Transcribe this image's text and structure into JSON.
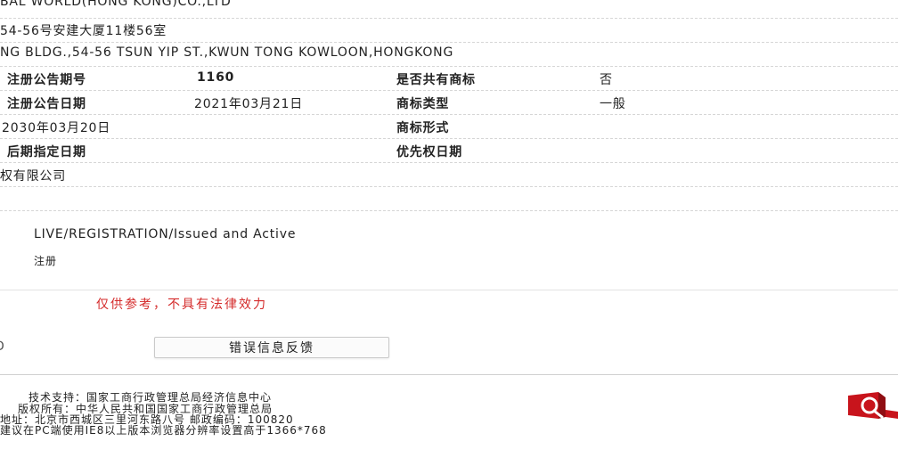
{
  "applicant": {
    "name_en": "BAL WORLD(HONG KONG)CO.,LTD",
    "address_cn": "54-56号安建大厦11楼56室",
    "address_en": "NG BLDG.,54-56 TSUN YIP ST.,KWUN TONG KOWLOON,HONGKONG"
  },
  "fields": {
    "reg_issue_no_label": "注册公告期号",
    "reg_issue_no_value": "1160",
    "shared_label": "是否共有商标",
    "shared_value": "否",
    "reg_date_label": "注册公告日期",
    "reg_date_value": "2021年03月21日",
    "type_label": "商标类型",
    "type_value": "一般",
    "expiry_value": "2030年03月20日",
    "form_label": "商标形式",
    "later_date_label": "后期指定日期",
    "priority_label": "优先权日期",
    "agent_value": "权有限公司"
  },
  "status": {
    "english": "LIVE/REGISTRATION/Issued and Active",
    "chinese": "注册"
  },
  "notice": "仅供参考，不具有法律效力",
  "left_fragment": "D",
  "feedback_button": "错误信息反馈",
  "footer": {
    "tech_support": "技术支持：国家工商行政管理总局经济信息中心",
    "copyright": "版权所有：中华人民共和国国家工商行政管理总局",
    "address": "地址：北京市西城区三里河东路八号   邮政编码：100820",
    "browser_tip": "建议在PC端使用IE8以上版本浏览器分辨率设置高于1366*768"
  },
  "icons": {
    "logo": "red-magnifier-logo-icon"
  },
  "colors": {
    "notice_red": "#d42a2a",
    "logo_red": "#c8141c"
  }
}
